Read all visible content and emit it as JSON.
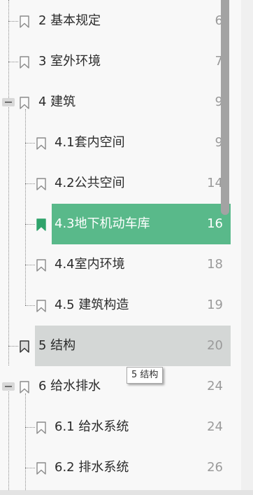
{
  "bookmarks": [
    {
      "title": "2  基本规定",
      "page": "6"
    },
    {
      "title": "3  室外环境",
      "page": "7"
    },
    {
      "title": "4  建筑",
      "page": "9"
    },
    {
      "title": "4.1套内空间",
      "page": "9"
    },
    {
      "title": "4.2公共空间",
      "page": "14"
    },
    {
      "title": "4.3地下机动车库",
      "page": "16"
    },
    {
      "title": "4.4室内环境",
      "page": "18"
    },
    {
      "title": "4.5 建筑构造",
      "page": "19"
    },
    {
      "title": "5  结构",
      "page": "20"
    },
    {
      "title": "6  给水排水",
      "page": "24"
    },
    {
      "title": "6.1 给水系统",
      "page": "24"
    },
    {
      "title": "6.2 排水系统",
      "page": "26"
    }
  ],
  "tooltip": "5  结构",
  "colors": {
    "active_highlight": "#59b98a",
    "hover_highlight": "#d4d7d6",
    "background": "#f8f8f8"
  },
  "icons": {
    "bookmark": "bookmark-icon",
    "collapse": "collapse-minus-icon"
  }
}
